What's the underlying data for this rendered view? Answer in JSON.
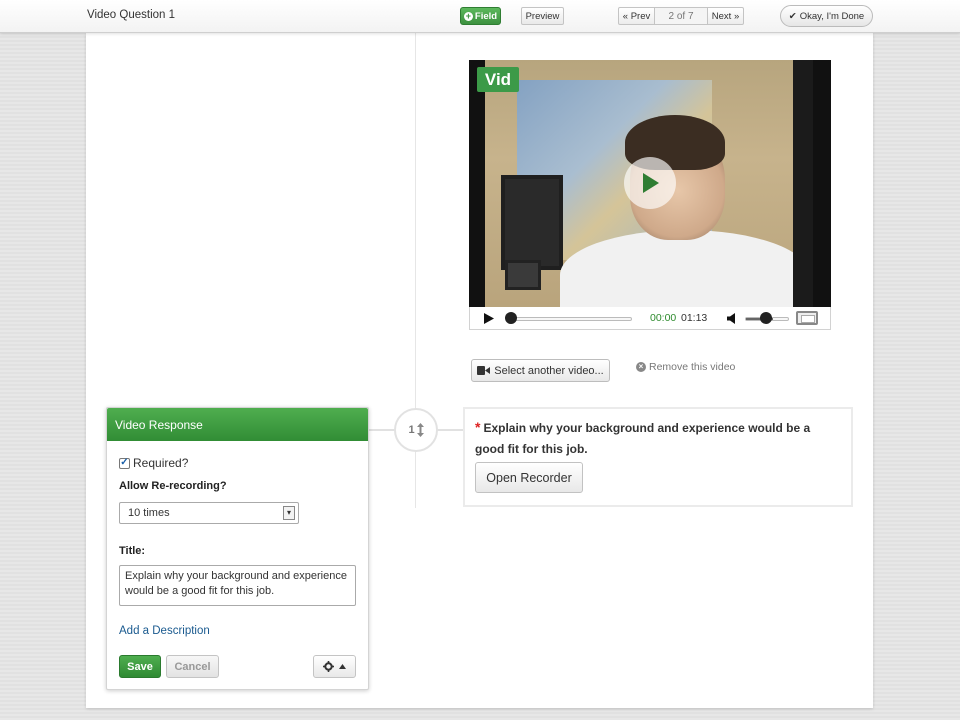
{
  "topbar": {
    "title": "Video Question 1",
    "field_button": "Field",
    "preview_button": "Preview",
    "prev_button": "« Prev",
    "page_indicator": "2 of 7",
    "next_button": "Next »",
    "done_button": "Okay, I'm Done"
  },
  "video": {
    "badge": "Vid",
    "current_time": "00:00",
    "duration": "01:13",
    "progress_fraction": 0.0,
    "volume_fraction": 0.65
  },
  "video_actions": {
    "select_label": "Select another video...",
    "remove_label": "Remove this video"
  },
  "order_badge": {
    "number": "1"
  },
  "question": {
    "text": "Explain why your background and experience would be a good fit for this job.",
    "recorder_button": "Open Recorder"
  },
  "panel": {
    "header": "Video Response",
    "required_label": "Required?",
    "required_checked": true,
    "rerecording_label": "Allow Re-recording?",
    "rerecording_value": "10 times",
    "title_label": "Title:",
    "title_value": "Explain why your background and experience would be a good fit for this job.",
    "add_description": "Add a Description",
    "save_button": "Save",
    "cancel_button": "Cancel"
  },
  "colors": {
    "accent_green": "#3d9140",
    "link_blue": "#1a5a8f",
    "time_green": "#2e8b2e"
  }
}
